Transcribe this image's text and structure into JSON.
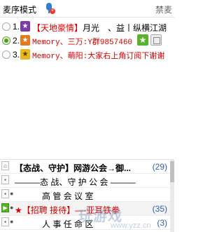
{
  "header": {
    "mode": "麦序模式",
    "mute": "禁麦"
  },
  "queue": [
    {
      "num": "1.",
      "badge": "★",
      "text_red": "【天地豪情】",
      "text": "月光　、益丨纵横江湖"
    },
    {
      "num": "2.",
      "badge": "★",
      "text_red": "",
      "text": "Memory、三万:Y群9857460"
    },
    {
      "num": "3.",
      "badge": "★",
      "text_red": "",
      "text": "Memory、萌阳:大家右上角订阅下谢谢"
    }
  ],
  "channels": [
    {
      "text": "【态战、守护】网游公会→御...",
      "count": "(29)"
    },
    {
      "text": "———态 战、守 护 公 会 ———",
      "count": ""
    },
    {
      "text": "高 管 会 议 室",
      "count": ""
    },
    {
      "text": "★【招聘 接待】—-亚耳铁拳",
      "count": "(35)"
    },
    {
      "text": "人 事 任 命 区",
      "count": "(3)"
    }
  ],
  "watermark": {
    "text": "玩游戏",
    "sub": "www.yzz.cn"
  }
}
